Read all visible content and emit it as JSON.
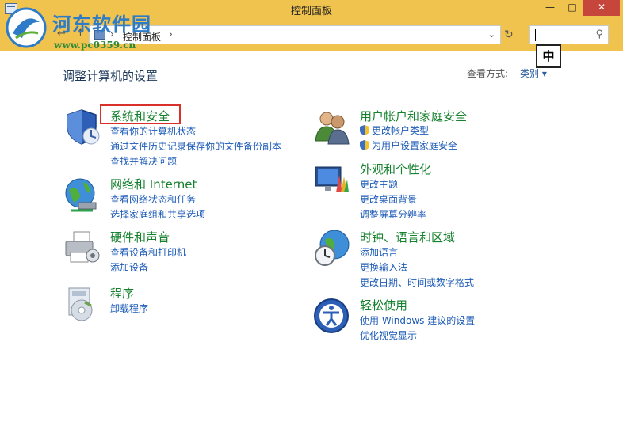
{
  "window": {
    "title": "控制面板",
    "min_label": "—",
    "max_label": "□",
    "close_label": "✕"
  },
  "watermark": {
    "title": "河东软件园",
    "url": "www.pc0359.cn"
  },
  "address": {
    "crumb": "控制面板",
    "sep": "›",
    "search_placeholder": ""
  },
  "ime": {
    "label": "中"
  },
  "main": {
    "heading": "调整计算机的设置",
    "view_by_label": "查看方式:",
    "view_by_value": "类别"
  },
  "categories_left": [
    {
      "title": "系统和安全",
      "icon": "shield-icon",
      "links": [
        "查看你的计算机状态",
        "通过文件历史记录保存你的文件备份副本",
        "查找并解决问题"
      ]
    },
    {
      "title": "网络和 Internet",
      "icon": "globe-network-icon",
      "links": [
        "查看网络状态和任务",
        "选择家庭组和共享选项"
      ]
    },
    {
      "title": "硬件和声音",
      "icon": "printer-icon",
      "links": [
        "查看设备和打印机",
        "添加设备"
      ]
    },
    {
      "title": "程序",
      "icon": "programs-icon",
      "links": [
        "卸载程序"
      ]
    }
  ],
  "categories_right": [
    {
      "title": "用户帐户和家庭安全",
      "icon": "users-icon",
      "links": [
        "更改帐户类型",
        "为用户设置家庭安全"
      ]
    },
    {
      "title": "外观和个性化",
      "icon": "appearance-icon",
      "links": [
        "更改主题",
        "更改桌面背景",
        "调整屏幕分辨率"
      ]
    },
    {
      "title": "时钟、语言和区域",
      "icon": "clock-globe-icon",
      "links": [
        "添加语言",
        "更换输入法",
        "更改日期、时间或数字格式"
      ]
    },
    {
      "title": "轻松使用",
      "icon": "ease-of-access-icon",
      "links": [
        "使用 Windows 建议的设置",
        "优化视觉显示"
      ]
    }
  ],
  "colors": {
    "titlebar": "#f0c24e",
    "category_title": "#16812e",
    "link": "#1d5bb7",
    "highlight": "#d9302c"
  }
}
